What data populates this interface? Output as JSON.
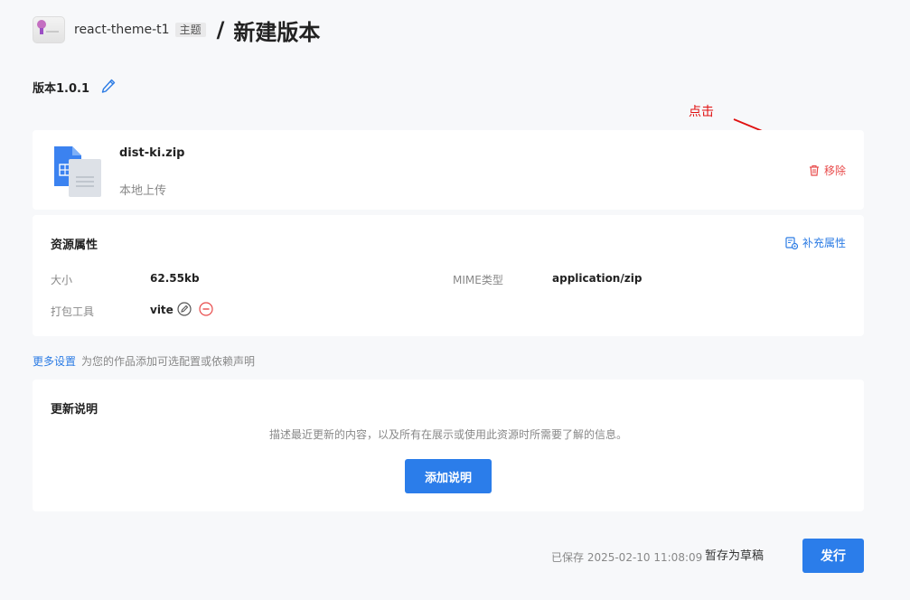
{
  "header": {
    "app_name": "react-theme-t1",
    "tag": "主题",
    "separator": "/",
    "page_title": "新建版本"
  },
  "version": {
    "label": "版本1.0.1",
    "edit_icon": "pencil-icon"
  },
  "annotation": {
    "text": "点击",
    "color": "#e01010"
  },
  "file": {
    "icon": "file-icon",
    "name": "dist-ki.zip",
    "source": "本地上传",
    "remove_label": "移除",
    "remove_icon": "trash-icon"
  },
  "attributes": {
    "title": "资源属性",
    "supplement_label": "补充属性",
    "supplement_icon": "settings-doc-icon",
    "size_label": "大小",
    "size_value": "62.55kb",
    "mime_label": "MIME类型",
    "mime_value": "application/zip",
    "tool_label": "打包工具",
    "tool_value": "vite",
    "tool_edit_icon": "edit-circle-icon",
    "tool_remove_icon": "minus-circle-icon"
  },
  "more_settings": {
    "link": "更多设置",
    "description": "为您的作品添加可选配置或依赖声明"
  },
  "notes": {
    "title": "更新说明",
    "description": "描述最近更新的内容，以及所有在展示或使用此资源时所需要了解的信息。",
    "add_label": "添加说明"
  },
  "footer": {
    "saved_text": "已保存 2025-02-10 11:08:09",
    "draft_label": "暂存为草稿",
    "publish_label": "发行"
  },
  "colors": {
    "accent": "#2b7dea",
    "danger": "#e84b4b",
    "background": "#f7f8fa"
  }
}
